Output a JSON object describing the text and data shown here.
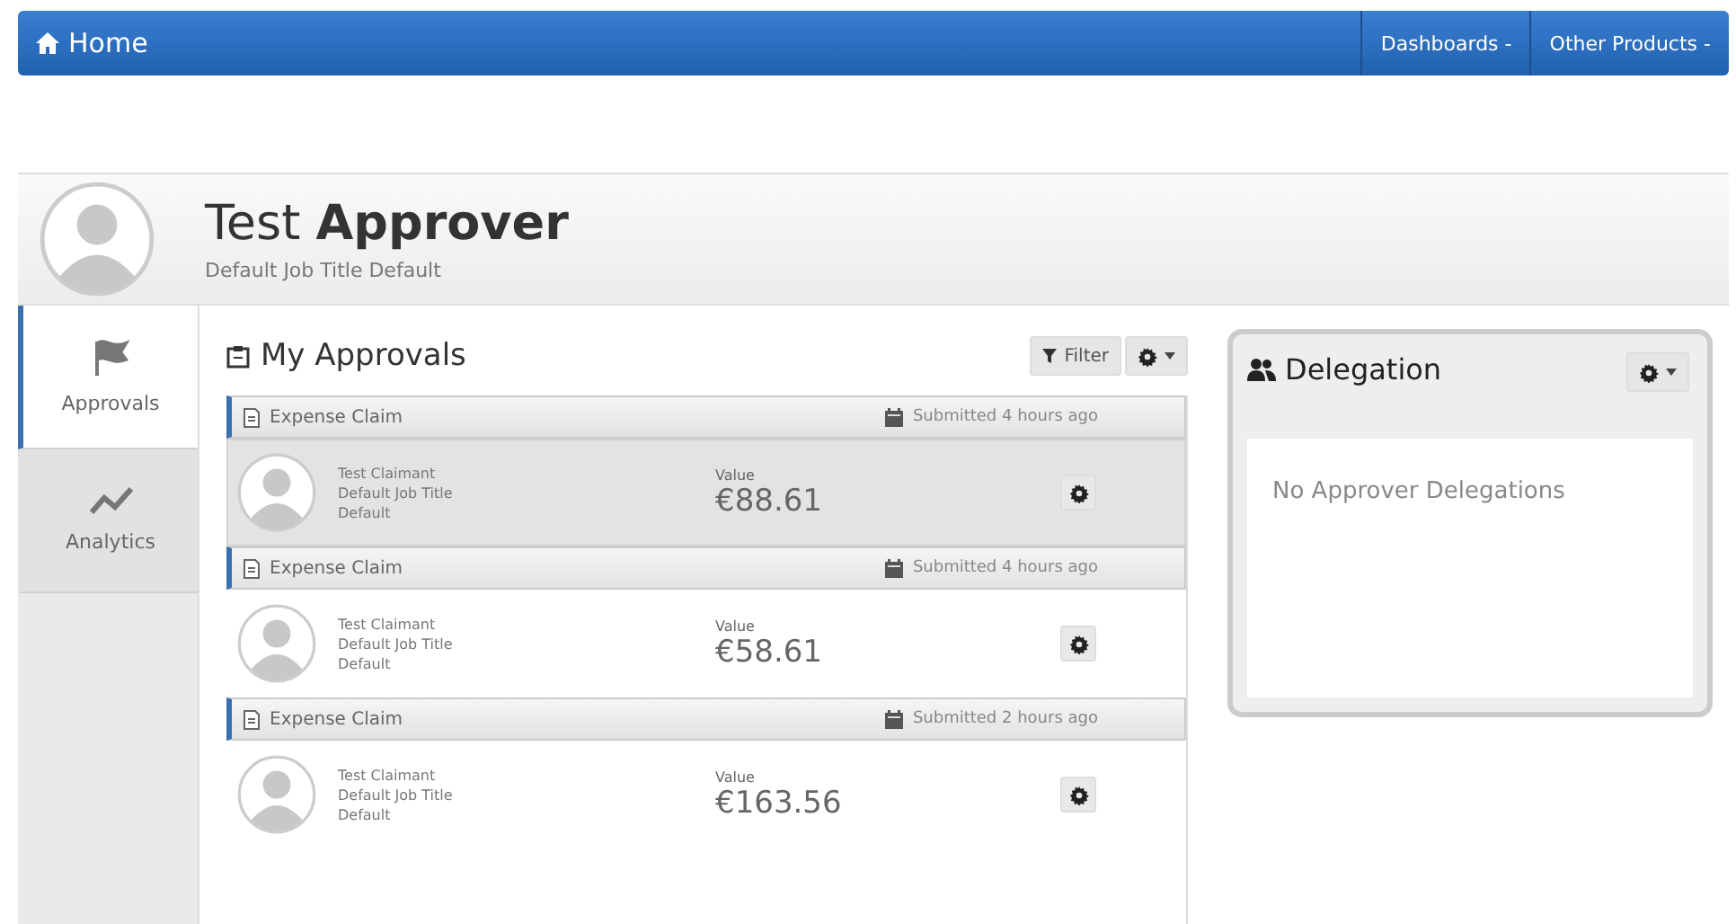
{
  "navbar": {
    "home": "Home",
    "menus": [
      {
        "label": "Dashboards",
        "caret": "-"
      },
      {
        "label": "Other Products",
        "caret": "-"
      }
    ]
  },
  "profile": {
    "name": "Test **Approver**",
    "subtitle": "Default Job Title Default"
  },
  "sidebar": {
    "tabs": [
      {
        "label": "Approvals",
        "kind": "flag",
        "selected": true
      },
      {
        "label": "Analytics",
        "kind": "chart",
        "selected": false
      }
    ]
  },
  "approvals": {
    "title": "My Approvals",
    "filter": "Filter",
    "items": [
      {
        "type": "Expense Claim",
        "submitted": "Submitted 4 hours ago",
        "claimant": "Test Claimant",
        "job": "Default Job Title",
        "dept": "Default",
        "value_label": "Value",
        "value": "€88.61",
        "selected": true
      },
      {
        "type": "Expense Claim",
        "submitted": "Submitted 4 hours ago",
        "claimant": "Test Claimant",
        "job": "Default Job Title",
        "dept": "Default",
        "value_label": "Value",
        "value": "€58.61",
        "selected": false
      },
      {
        "type": "Expense Claim",
        "submitted": "Submitted 2 hours ago",
        "claimant": "Test Claimant",
        "job": "Default Job Title",
        "dept": "Default",
        "value_label": "Value",
        "value": "€163.56",
        "selected": false
      }
    ]
  },
  "delegation": {
    "title": "Delegation",
    "empty": "No Approver Delegations"
  }
}
